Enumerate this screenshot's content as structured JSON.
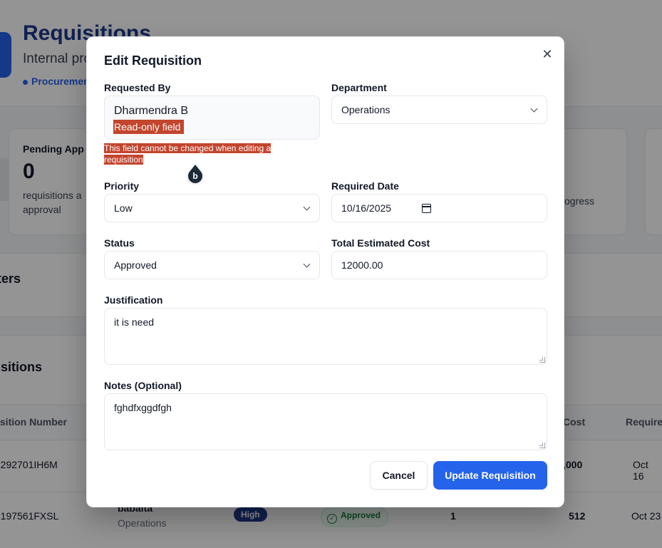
{
  "background": {
    "title": "Requisitions",
    "subtitle": "Internal pro",
    "breadcrumb": "Procuremen",
    "stat_card": {
      "title": "Pending App",
      "value": "0",
      "description": "requisitions a approval"
    },
    "stat_card_right": "ogress",
    "filters_heading": "ters",
    "list_heading": "isitions",
    "table": {
      "headers": {
        "number": "isition Number",
        "cost": "Cost",
        "required": "Require"
      },
      "rows": [
        {
          "number": "-292701IH6M",
          "cost": ",000",
          "required": "Oct 16"
        },
        {
          "number": "-197561FXSL",
          "requester": "babaita",
          "department": "Operations",
          "priority": "High",
          "status": "Approved",
          "items": "1",
          "cost": "512",
          "required": "Oct 23"
        }
      ]
    }
  },
  "modal": {
    "title": "Edit Requisition",
    "close_icon": "close-icon",
    "requested_by": {
      "label": "Requested By",
      "value": "Dharmendra B",
      "readonly_tag": "Read-only field",
      "helper": "This field cannot be changed when editing a requisition"
    },
    "department": {
      "label": "Department",
      "value": "Operations"
    },
    "priority": {
      "label": "Priority",
      "value": "Low"
    },
    "required_date": {
      "label": "Required Date",
      "value": "10/16/2025"
    },
    "status": {
      "label": "Status",
      "value": "Approved"
    },
    "total_cost": {
      "label": "Total Estimated Cost",
      "value": "12000.00"
    },
    "justification": {
      "label": "Justification",
      "value": "it is need"
    },
    "notes": {
      "label": "Notes (Optional)",
      "value": "fghdfxggdfgh"
    },
    "cancel_label": "Cancel",
    "update_label": "Update Requisition"
  },
  "colors": {
    "accent": "#2563eb",
    "highlight": "#c2452d",
    "overlay": "rgba(0,0,0,0.42)"
  }
}
